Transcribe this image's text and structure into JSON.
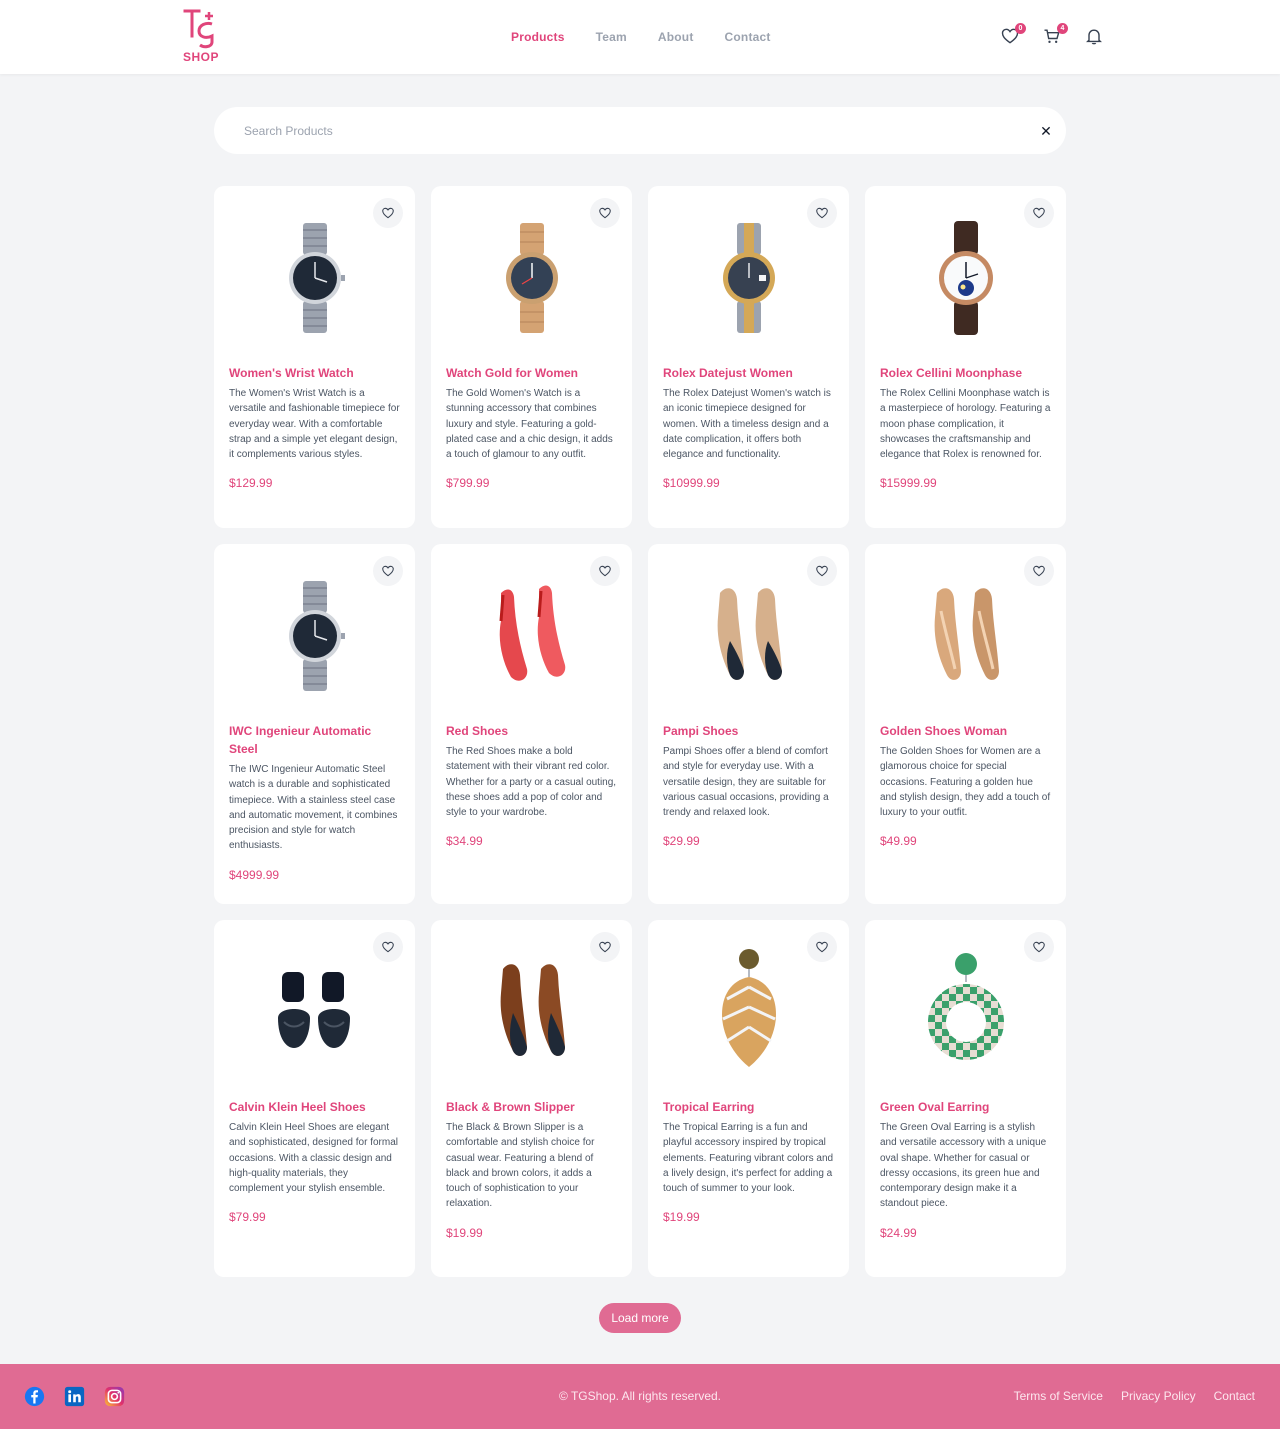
{
  "header": {
    "logo_text": "SHOP",
    "nav": [
      {
        "label": "Products",
        "active": true
      },
      {
        "label": "Team",
        "active": false
      },
      {
        "label": "About",
        "active": false
      },
      {
        "label": "Contact",
        "active": false
      }
    ],
    "wishlist_count": "0",
    "cart_count": "4",
    "accent_color": "#e0457b"
  },
  "search": {
    "placeholder": "Search Products",
    "value": "",
    "clear_icon": "close-icon"
  },
  "products": [
    {
      "name": "Women's Wrist Watch",
      "description": "The Women's Wrist Watch is a versatile and fashionable timepiece for everyday wear. With a comfortable strap and a simple yet elegant design, it complements various styles.",
      "price": "$129.99",
      "image": "steel-watch-black-dial"
    },
    {
      "name": "Watch Gold for Women",
      "description": "The Gold Women's Watch is a stunning accessory that combines luxury and style. Featuring a gold-plated case and a chic design, it adds a touch of glamour to any outfit.",
      "price": "$799.99",
      "image": "gold-watch-blue-dial"
    },
    {
      "name": "Rolex Datejust Women",
      "description": "The Rolex Datejust Women's watch is an iconic timepiece designed for women. With a timeless design and a date complication, it offers both elegance and functionality.",
      "price": "$10999.99",
      "image": "two-tone-watch"
    },
    {
      "name": "Rolex Cellini Moonphase",
      "description": "The Rolex Cellini Moonphase watch is a masterpiece of horology. Featuring a moon phase complication, it showcases the craftsmanship and elegance that Rolex is renowned for.",
      "price": "$15999.99",
      "image": "leather-watch-moonphase"
    },
    {
      "name": "IWC Ingenieur Automatic Steel",
      "description": "The IWC Ingenieur Automatic Steel watch is a durable and sophisticated timepiece. With a stainless steel case and automatic movement, it combines precision and style for watch enthusiasts.",
      "price": "$4999.99",
      "image": "steel-watch-black-dial"
    },
    {
      "name": "Red Shoes",
      "description": "The Red Shoes make a bold statement with their vibrant red color. Whether for a party or a casual outing, these shoes add a pop of color and style to your wardrobe.",
      "price": "$34.99",
      "image": "red-heels"
    },
    {
      "name": "Pampi Shoes",
      "description": "Pampi Shoes offer a blend of comfort and style for everyday use. With a versatile design, they are suitable for various casual occasions, providing a trendy and relaxed look.",
      "price": "$29.99",
      "image": "nude-black-heels"
    },
    {
      "name": "Golden Shoes Woman",
      "description": "The Golden Shoes for Women are a glamorous choice for special occasions. Featuring a golden hue and stylish design, they add a touch of luxury to your outfit.",
      "price": "$49.99",
      "image": "golden-heels"
    },
    {
      "name": "Calvin Klein Heel Shoes",
      "description": "Calvin Klein Heel Shoes are elegant and sophisticated, designed for formal occasions. With a classic design and high-quality materials, they complement your stylish ensemble.",
      "price": "$79.99",
      "image": "black-sandals"
    },
    {
      "name": "Black & Brown Slipper",
      "description": "The Black & Brown Slipper is a comfortable and stylish choice for casual wear. Featuring a blend of black and brown colors, it adds a touch of sophistication to your relaxation.",
      "price": "$19.99",
      "image": "brown-black-heels"
    },
    {
      "name": "Tropical Earring",
      "description": "The Tropical Earring is a fun and playful accessory inspired by tropical elements. Featuring vibrant colors and a lively design, it's perfect for adding a touch of summer to your look.",
      "price": "$19.99",
      "image": "leaf-earring"
    },
    {
      "name": "Green Oval Earring",
      "description": "The Green Oval Earring is a stylish and versatile accessory with a unique oval shape. Whether for casual or dressy occasions, its green hue and contemporary design make it a standout piece.",
      "price": "$24.99",
      "image": "green-checker-earring"
    }
  ],
  "load_more_label": "Load more",
  "footer": {
    "copyright": "© TGShop. All rights reserved.",
    "links": [
      "Terms of Service",
      "Privacy Policy",
      "Contact"
    ],
    "social": [
      "facebook-icon",
      "linkedin-icon",
      "instagram-icon"
    ]
  }
}
